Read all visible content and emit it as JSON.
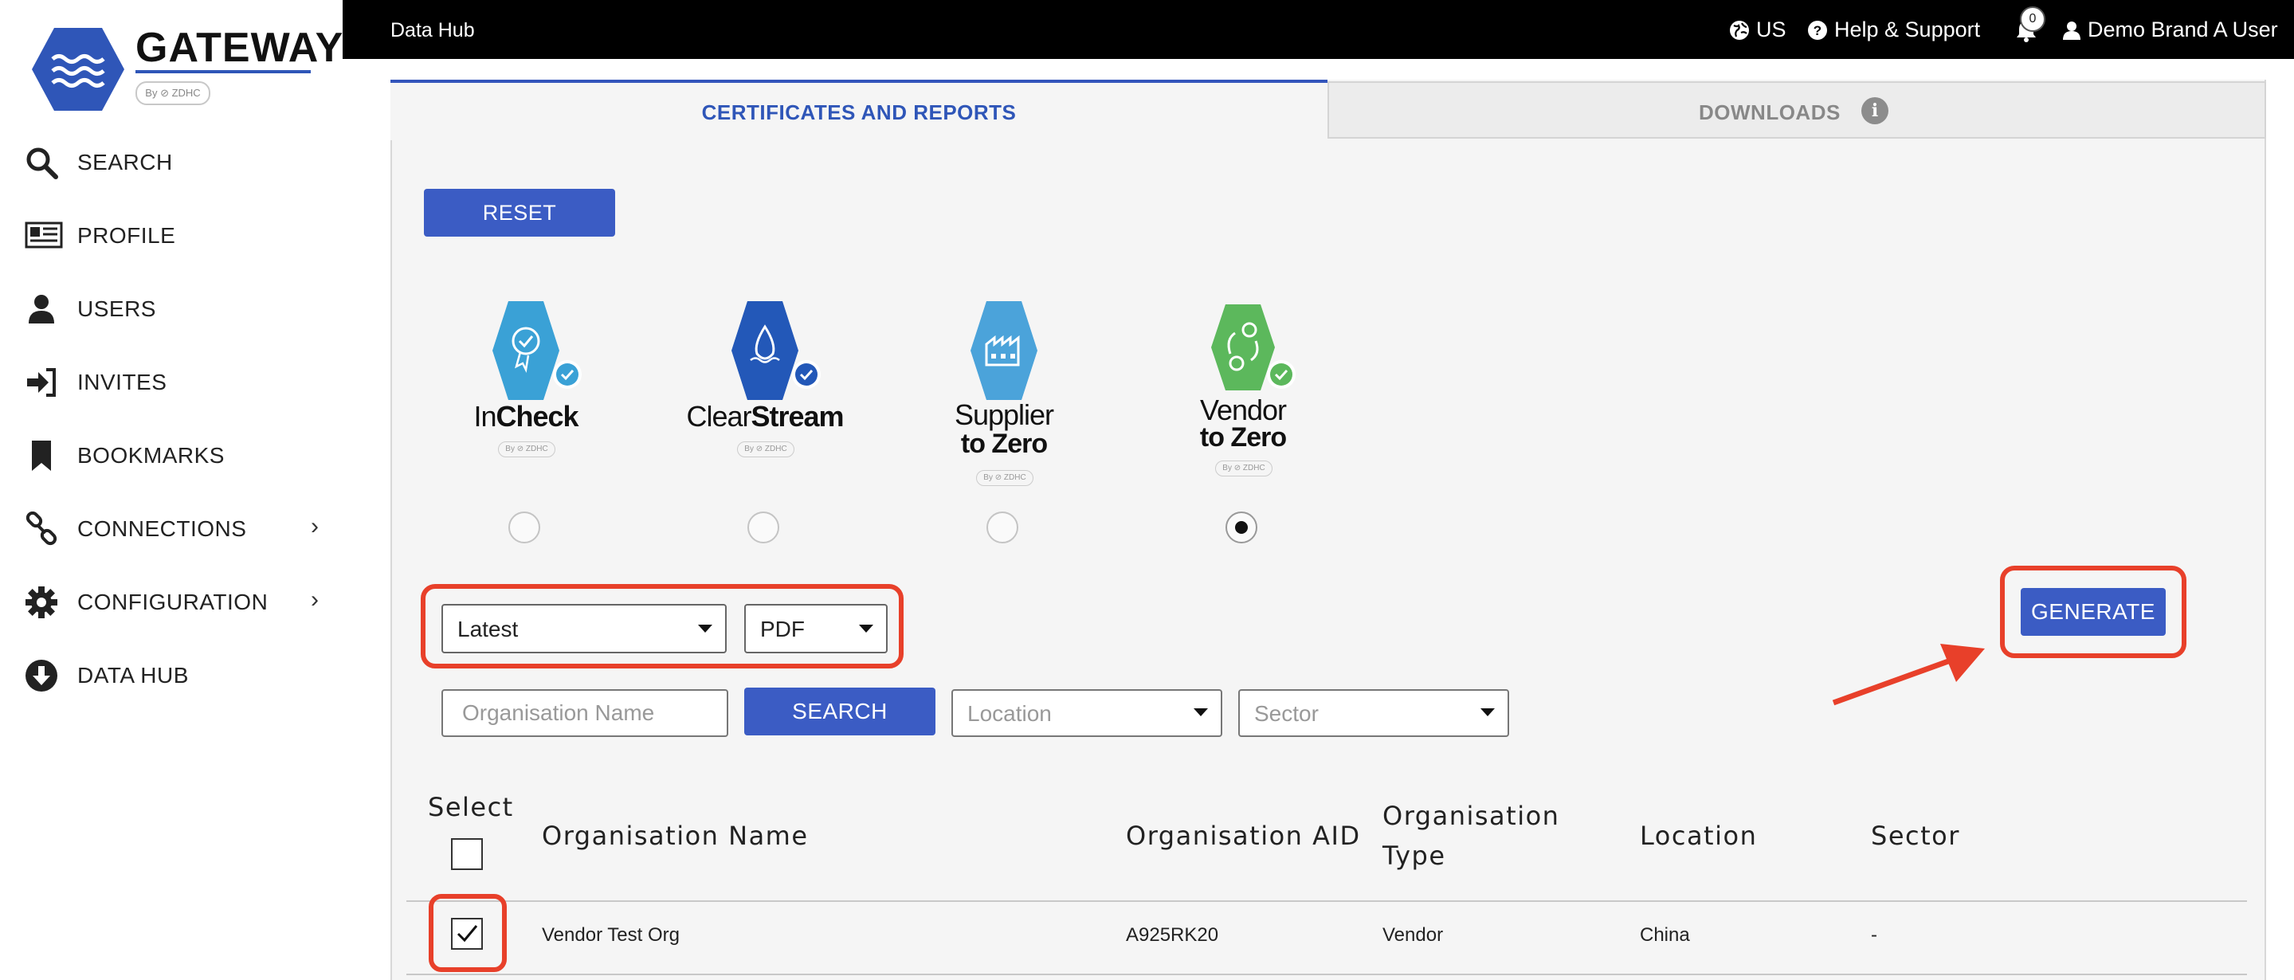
{
  "app": {
    "logo_text": "GATEWAY",
    "logo_byline": "By ⊘ ZDHC"
  },
  "sidebar": {
    "items": [
      {
        "label": "SEARCH",
        "icon": "search-icon"
      },
      {
        "label": "PROFILE",
        "icon": "profile-card-icon"
      },
      {
        "label": "USERS",
        "icon": "user-icon"
      },
      {
        "label": "INVITES",
        "icon": "sign-in-icon"
      },
      {
        "label": "BOOKMARKS",
        "icon": "bookmark-icon"
      },
      {
        "label": "CONNECTIONS",
        "icon": "link-icon",
        "has_submenu": true
      },
      {
        "label": "CONFIGURATION",
        "icon": "gear-icon",
        "has_submenu": true
      },
      {
        "label": "DATA HUB",
        "icon": "download-circle-icon"
      }
    ],
    "chevron": "›"
  },
  "topbar": {
    "title": "Data Hub",
    "region": "US",
    "help": "Help & Support",
    "notification_count": "0",
    "user": "Demo Brand A User"
  },
  "tabs": {
    "active": "CERTIFICATES AND REPORTS",
    "inactive": "DOWNLOADS",
    "info_glyph": "i"
  },
  "actions": {
    "reset": "RESET",
    "generate": "GENERATE",
    "search": "SEARCH"
  },
  "products": [
    {
      "name_a": "In",
      "name_b": "Check",
      "byline": "By ⊘ ZDHC",
      "color": "#3aa1d6",
      "selected": false
    },
    {
      "name_a": "Clear",
      "name_b": "Stream",
      "byline": "By ⊘ ZDHC",
      "color": "#2358b8",
      "selected": false
    },
    {
      "name_a": "Supplier",
      "name_b": "to Zero",
      "byline": "By ⊘ ZDHC",
      "color": "#4ba3da",
      "selected": false
    },
    {
      "name_a": "Vendor",
      "name_b": "to Zero",
      "byline": "By ⊘ ZDHC",
      "color": "#5cb85c",
      "selected": true
    }
  ],
  "filters": {
    "version": "Latest",
    "format": "PDF",
    "org_name_placeholder": "Organisation Name",
    "location_placeholder": "Location",
    "sector_placeholder": "Sector"
  },
  "table": {
    "headers": {
      "select": "Select",
      "name": "Organisation Name",
      "aid": "Organisation AID",
      "type_line1": "Organisation",
      "type_line2": "Type",
      "location": "Location",
      "sector": "Sector"
    },
    "rows": [
      {
        "name": "Vendor Test Org",
        "aid": "A925RK20",
        "type": "Vendor",
        "location": "China",
        "sector": "-",
        "checked": true
      }
    ]
  },
  "colors": {
    "accent": "#3b5cc4",
    "highlight": "#e8402a",
    "topbar": "#000000"
  }
}
